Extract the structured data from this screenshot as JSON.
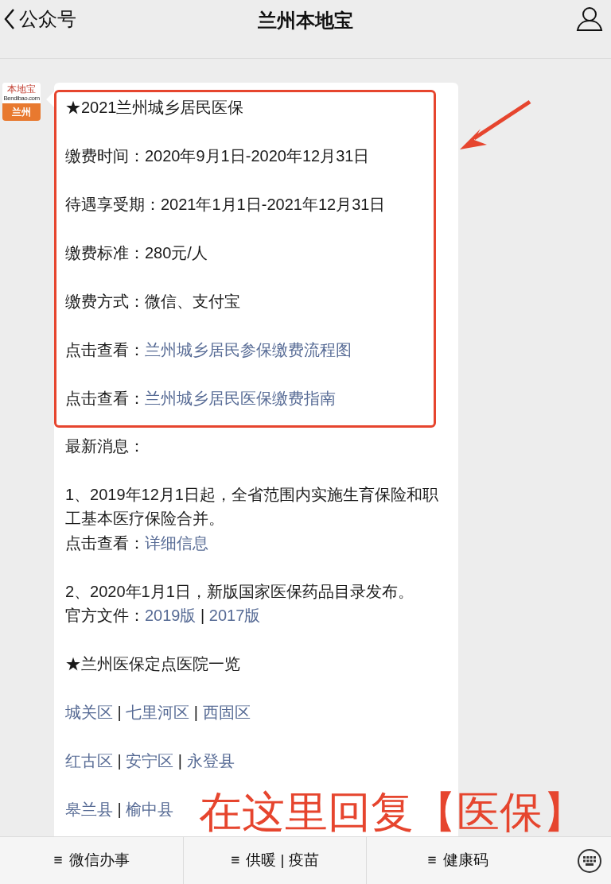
{
  "header": {
    "back_label": "公众号",
    "title": "兰州本地宝"
  },
  "avatar": {
    "logo_text": "本地宝",
    "logo_subtext": "Bendibao.com",
    "city": "兰州"
  },
  "message": {
    "highlighted_blocks": [
      [
        [
          {
            "text": "★2021兰州城乡居民医保",
            "link": false
          }
        ]
      ],
      [
        [
          {
            "text": "缴费时间：2020年9月1日-2020年12月31日",
            "link": false
          }
        ]
      ],
      [
        [
          {
            "text": "待遇享受期：2021年1月1日-2021年12月31日",
            "link": false
          }
        ]
      ],
      [
        [
          {
            "text": "缴费标准：280元/人",
            "link": false
          }
        ]
      ],
      [
        [
          {
            "text": "缴费方式：微信、支付宝",
            "link": false
          }
        ]
      ],
      [
        [
          {
            "text": "点击查看：",
            "link": false
          },
          {
            "text": "兰州城乡居民参保缴费流程图",
            "link": true
          }
        ]
      ],
      [
        [
          {
            "text": "点击查看：",
            "link": false
          },
          {
            "text": "兰州城乡居民医保缴费指南",
            "link": true
          }
        ]
      ]
    ],
    "blocks": [
      [
        [
          {
            "text": "最新消息：",
            "link": false
          }
        ]
      ],
      [
        [
          {
            "text": "1、2019年12月1日起，全省范围内实施生育保险和职工基本医疗保险合并。",
            "link": false
          }
        ],
        [
          {
            "text": "点击查看：",
            "link": false
          },
          {
            "text": "详细信息",
            "link": true
          }
        ]
      ],
      [
        [
          {
            "text": "2、2020年1月1日，新版国家医保药品目录发布。",
            "link": false
          }
        ],
        [
          {
            "text": "官方文件：",
            "link": false
          },
          {
            "text": "2019版",
            "link": true
          },
          {
            "text": " | ",
            "link": false
          },
          {
            "text": "2017版",
            "link": true
          }
        ]
      ],
      [
        [
          {
            "text": "★兰州医保定点医院一览",
            "link": false
          }
        ]
      ],
      [
        [
          {
            "text": "城关区",
            "link": true
          },
          {
            "text": " | ",
            "link": false
          },
          {
            "text": "七里河区",
            "link": true
          },
          {
            "text": " | ",
            "link": false
          },
          {
            "text": "西固区",
            "link": true
          }
        ]
      ],
      [
        [
          {
            "text": "红古区",
            "link": true
          },
          {
            "text": " | ",
            "link": false
          },
          {
            "text": "安宁区",
            "link": true
          },
          {
            "text": " | ",
            "link": false
          },
          {
            "text": "永登县",
            "link": true
          }
        ]
      ],
      [
        [
          {
            "text": "皋兰县",
            "link": true
          },
          {
            "text": " | ",
            "link": false
          },
          {
            "text": "榆中县",
            "link": true
          }
        ]
      ]
    ]
  },
  "menu": [
    {
      "icon": "≡",
      "label": "微信办事"
    },
    {
      "icon": "≡",
      "label": "供暖 | 疫苗"
    },
    {
      "icon": "≡",
      "label": "健康码"
    }
  ],
  "annotation": {
    "text": "在这里回复【医保】"
  }
}
